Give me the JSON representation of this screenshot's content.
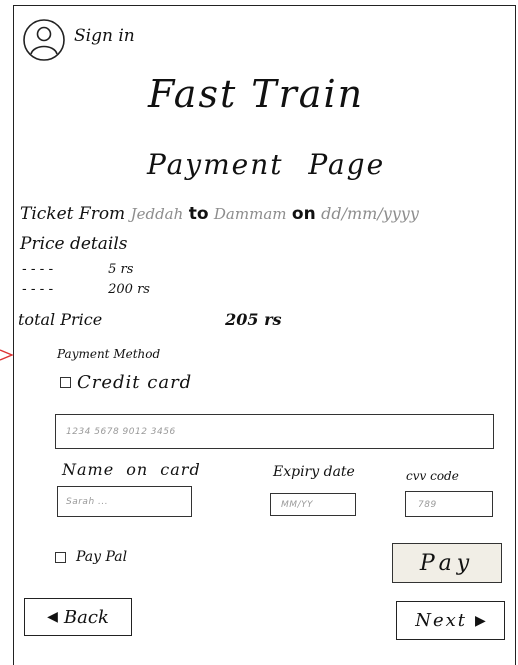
{
  "header": {
    "sign_in": "Sign in",
    "app_title": "Fast Train",
    "page_title": "Payment Page"
  },
  "ticket": {
    "from_prefix": "Ticket From",
    "from": "Jeddah",
    "to_word": "to",
    "to": "Dammam",
    "on_word": "on",
    "date": "dd/mm/yyyy"
  },
  "price": {
    "heading": "Price details",
    "lines": [
      {
        "label": "- - - -",
        "value": "5 rs"
      },
      {
        "label": "- - - -",
        "value": "200 rs"
      }
    ],
    "total_label": "total Price",
    "total_value": "205 rs"
  },
  "payment": {
    "method_label": "Payment Method",
    "credit_card_label": "Credit card",
    "card_number_placeholder": "1234 5678 9012 3456",
    "name_label": "Name on card",
    "name_placeholder": "Sarah ...",
    "expiry_label": "Expiry date",
    "expiry_placeholder": "MM/YY",
    "cvv_label": "cvv code",
    "cvv_placeholder": "789",
    "paypal_label": "Pay Pal",
    "pay_button": "Pay"
  },
  "nav": {
    "back": "Back",
    "next": "Next"
  }
}
